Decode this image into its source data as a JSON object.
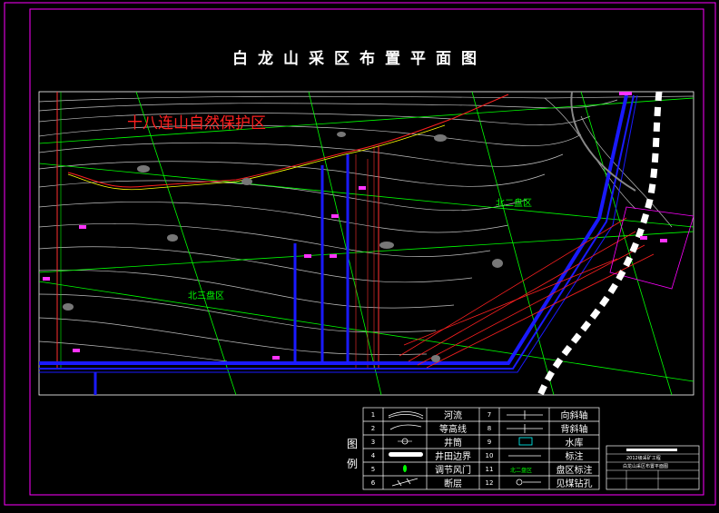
{
  "title": "白龙山采区布置平面图",
  "map_labels": {
    "reserve": "十八连山自然保护区",
    "north2": "北二盘区",
    "north3": "北三盘区"
  },
  "legend": {
    "header": "图例",
    "items": [
      {
        "no": "1",
        "label": "河流"
      },
      {
        "no": "2",
        "label": "等高线"
      },
      {
        "no": "3",
        "label": "井筒"
      },
      {
        "no": "4",
        "label": "井田边界"
      },
      {
        "no": "5",
        "label": "调节风门"
      },
      {
        "no": "6",
        "label": "断层"
      },
      {
        "no": "7",
        "label": "向斜轴"
      },
      {
        "no": "8",
        "label": "背斜轴"
      },
      {
        "no": "9",
        "label": "水库"
      },
      {
        "no": "10",
        "label": "标注"
      },
      {
        "no": "11",
        "label": "盘区标注"
      },
      {
        "no": "12",
        "label": "见煤钻孔"
      }
    ],
    "symbol11": "北二盘区"
  },
  "title_block": {
    "line1": "2012级采矿工程",
    "line2": "白龙山采区布置平面图"
  },
  "colors": {
    "frame": "#ff00ff",
    "grid": "#00ff00",
    "roadway": "#0000ff",
    "contour": "#ffffff",
    "reserve_text": "#ff0000"
  }
}
